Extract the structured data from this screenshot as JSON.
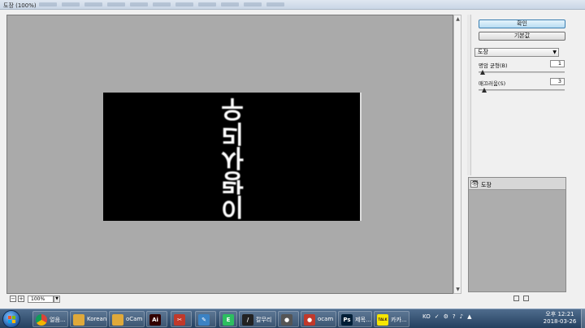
{
  "window": {
    "title": "도장 (100%)"
  },
  "preview": {
    "glyphs": [
      "우",
      "리",
      "사",
      "랑",
      "이"
    ]
  },
  "statusbar": {
    "zoom_out": "−",
    "zoom_in": "+",
    "zoom_value": "100%",
    "zoom_drop": "▼"
  },
  "panel": {
    "ok_label": "확인",
    "default_label": "기본값",
    "filter_selected": "도장",
    "params": [
      {
        "label": "명암 균형(B)",
        "value": "1",
        "slider_fraction": 0.02
      },
      {
        "label": "매끄러움(S)",
        "value": "3",
        "slider_fraction": 0.04
      }
    ],
    "layer_name": "도장"
  },
  "taskbar": {
    "items": [
      {
        "label": "얼음...",
        "icon": "chrome-icon",
        "color": "#dd4b39"
      },
      {
        "label": "Korean",
        "icon": "folder-icon",
        "color": "#e0a93a"
      },
      {
        "label": "oCam",
        "icon": "folder-icon",
        "color": "#e0a93a"
      },
      {
        "label": "",
        "icon": "illustrator-icon",
        "color": "#330000",
        "text": "Ai"
      },
      {
        "label": "",
        "icon": "snipping-tool-icon",
        "color": "#c0392b",
        "text": "✂"
      },
      {
        "label": "",
        "icon": "notepad-icon",
        "color": "#3b82c4",
        "text": "✎"
      },
      {
        "label": "",
        "icon": "evernote-icon",
        "color": "#2dbe60",
        "text": "E"
      },
      {
        "label": "칼무리",
        "icon": "app-icon",
        "color": "#222222",
        "text": "/"
      },
      {
        "label": "",
        "icon": "app-icon",
        "color": "#555555",
        "text": "●"
      },
      {
        "label": "ocam",
        "icon": "ocam-icon",
        "color": "#c0392b",
        "text": "●"
      },
      {
        "label": "제목...",
        "icon": "photoshop-icon",
        "color": "#001e36",
        "text": "Ps"
      },
      {
        "label": "카카...",
        "icon": "kakaotalk-icon",
        "color": "#f7e600",
        "text": "TALK"
      }
    ],
    "tray": [
      "KO",
      "✓",
      "⚙",
      "?",
      "♪",
      "▲"
    ],
    "clock_time": "오후 12:21",
    "clock_date": "2018-03-26"
  }
}
